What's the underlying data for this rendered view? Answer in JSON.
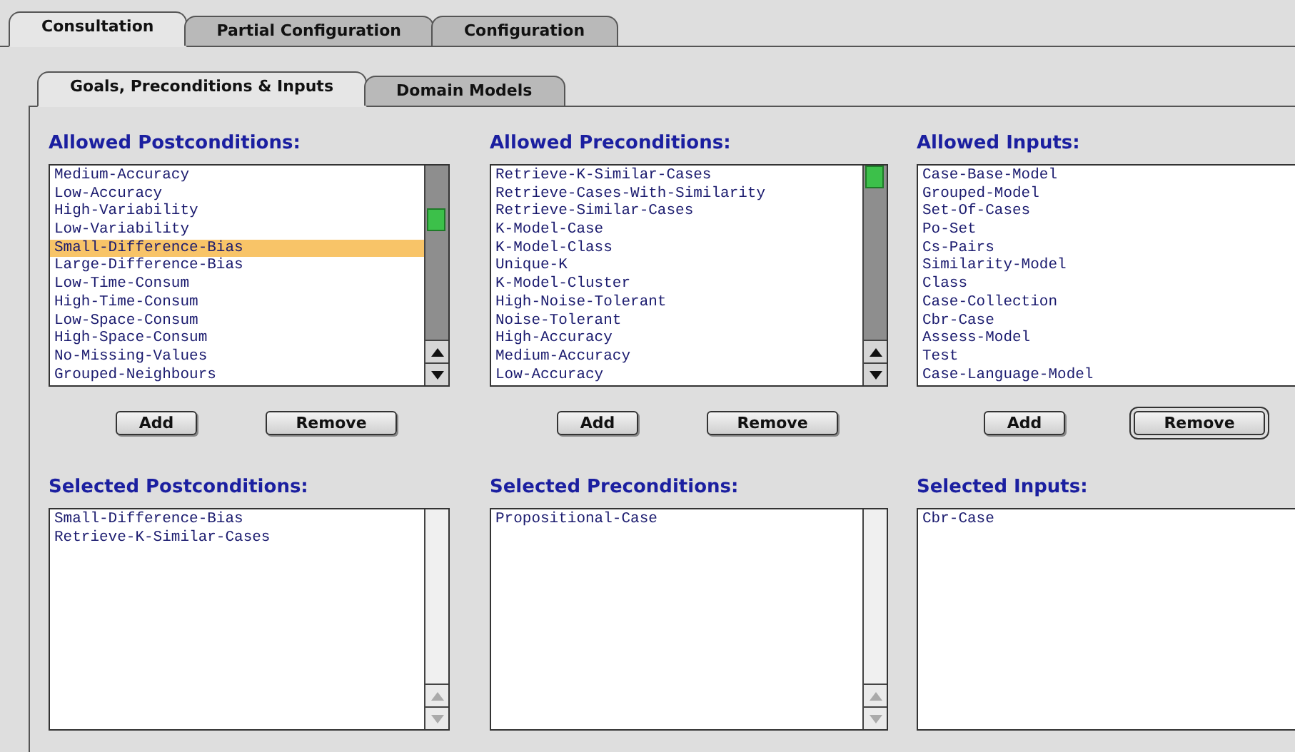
{
  "main_tabs": [
    {
      "label": "Consultation",
      "selected": true
    },
    {
      "label": "Partial Configuration",
      "selected": false
    },
    {
      "label": "Configuration",
      "selected": false
    }
  ],
  "sub_tabs": [
    {
      "label": "Goals, Preconditions & Inputs",
      "selected": true
    },
    {
      "label": "Domain Models",
      "selected": false
    }
  ],
  "columns": [
    {
      "allowed_title": "Allowed Postconditions:",
      "scrollbar": true,
      "allowed": [
        {
          "label": "Medium-Accuracy",
          "selected": false
        },
        {
          "label": "Low-Accuracy",
          "selected": false
        },
        {
          "label": "High-Variability",
          "selected": false
        },
        {
          "label": "Low-Variability",
          "selected": false
        },
        {
          "label": "Small-Difference-Bias",
          "selected": true
        },
        {
          "label": "Large-Difference-Bias",
          "selected": false
        },
        {
          "label": "Low-Time-Consum",
          "selected": false
        },
        {
          "label": "High-Time-Consum",
          "selected": false
        },
        {
          "label": "Low-Space-Consum",
          "selected": false
        },
        {
          "label": "High-Space-Consum",
          "selected": false
        },
        {
          "label": "No-Missing-Values",
          "selected": false
        },
        {
          "label": "Grouped-Neighbours",
          "selected": false
        }
      ],
      "buttons": [
        {
          "label": "Add",
          "default": false
        },
        {
          "label": "Remove",
          "default": false
        }
      ],
      "selected_title": "Selected Postconditions:",
      "selected_items": [
        {
          "label": "Small-Difference-Bias",
          "selected": false
        },
        {
          "label": "Retrieve-K-Similar-Cases",
          "selected": false
        }
      ]
    },
    {
      "allowed_title": "Allowed Preconditions:",
      "scrollbar": true,
      "allowed": [
        {
          "label": "Retrieve-K-Similar-Cases",
          "selected": false
        },
        {
          "label": "Retrieve-Cases-With-Similarity",
          "selected": false
        },
        {
          "label": "Retrieve-Similar-Cases",
          "selected": false
        },
        {
          "label": "K-Model-Case",
          "selected": false
        },
        {
          "label": "K-Model-Class",
          "selected": false
        },
        {
          "label": "Unique-K",
          "selected": false
        },
        {
          "label": "K-Model-Cluster",
          "selected": false
        },
        {
          "label": "High-Noise-Tolerant",
          "selected": false
        },
        {
          "label": "Noise-Tolerant",
          "selected": false
        },
        {
          "label": "High-Accuracy",
          "selected": false
        },
        {
          "label": "Medium-Accuracy",
          "selected": false
        },
        {
          "label": "Low-Accuracy",
          "selected": false
        }
      ],
      "buttons": [
        {
          "label": "Add",
          "default": false
        },
        {
          "label": "Remove",
          "default": false
        }
      ],
      "selected_title": "Selected Preconditions:",
      "selected_items": [
        {
          "label": "Propositional-Case",
          "selected": false
        }
      ]
    },
    {
      "allowed_title": "Allowed Inputs:",
      "scrollbar": false,
      "allowed": [
        {
          "label": "Case-Base-Model",
          "selected": false
        },
        {
          "label": "Grouped-Model",
          "selected": false
        },
        {
          "label": "Set-Of-Cases",
          "selected": false
        },
        {
          "label": "Po-Set",
          "selected": false
        },
        {
          "label": "Cs-Pairs",
          "selected": false
        },
        {
          "label": "Similarity-Model",
          "selected": false
        },
        {
          "label": "Class",
          "selected": false
        },
        {
          "label": "Case-Collection",
          "selected": false
        },
        {
          "label": "Cbr-Case",
          "selected": false
        },
        {
          "label": "Assess-Model",
          "selected": false
        },
        {
          "label": "Test",
          "selected": false
        },
        {
          "label": "Case-Language-Model",
          "selected": false
        }
      ],
      "buttons": [
        {
          "label": "Add",
          "default": false
        },
        {
          "label": "Remove",
          "default": true
        }
      ],
      "selected_title": "Selected Inputs:",
      "selected_items": [
        {
          "label": "Cbr-Case",
          "selected": false
        }
      ]
    }
  ]
}
